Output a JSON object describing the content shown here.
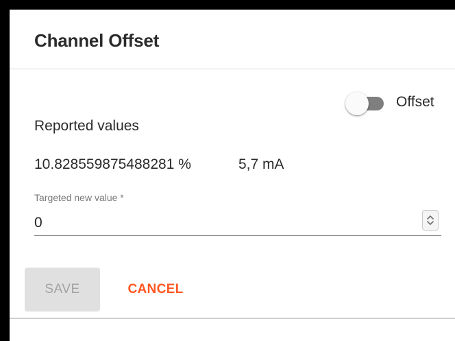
{
  "dialog": {
    "title": "Channel Offset"
  },
  "offset_toggle": {
    "label": "Offset",
    "checked": false
  },
  "reported": {
    "label": "Reported values",
    "percent_value": "10.828559875488281 %",
    "current_value": "5,7 mA"
  },
  "target_input": {
    "label": "Targeted new value *",
    "value": "0"
  },
  "actions": {
    "save_label": "SAVE",
    "cancel_label": "CANCEL"
  },
  "colors": {
    "accent": "#ff5722",
    "disabled_bg": "#e0e0e0",
    "disabled_text": "#a3a3a3",
    "toggle_track_off": "#7f7f7f"
  },
  "icons": {
    "spinner": "up-down-chevron-icon"
  }
}
